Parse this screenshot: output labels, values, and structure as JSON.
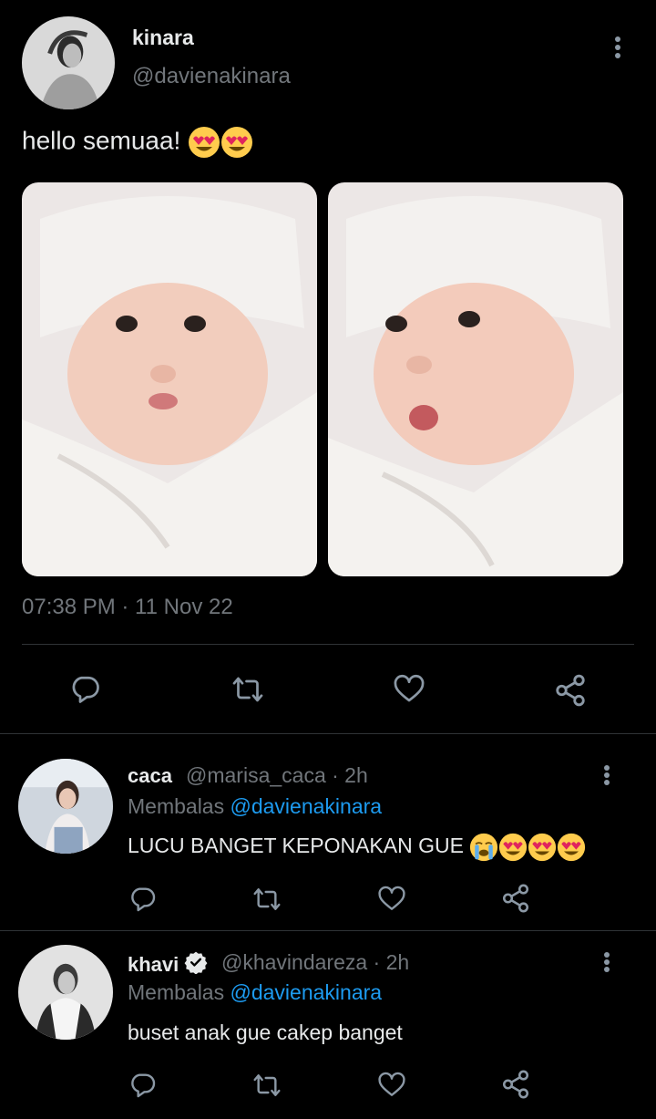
{
  "tweet": {
    "author_name": "kinara",
    "author_handle": "@davienakinara",
    "text": "hello semuaa!",
    "emojis": [
      "heart-eyes",
      "heart-eyes"
    ],
    "timestamp": "07:38 PM · 11 Nov 22",
    "actions": [
      "reply-icon",
      "retweet-icon",
      "like-icon",
      "share-icon"
    ]
  },
  "replies": [
    {
      "name": "caca",
      "meta": "@marisa_caca · 2h",
      "replying_prefix": "Membalas",
      "replying_to": "@davienakinara",
      "text": "LUCU BANGET KEPONAKAN GUE",
      "emojis": [
        "loudly-crying",
        "heart-eyes",
        "heart-eyes",
        "heart-eyes"
      ],
      "verified": false
    },
    {
      "name": "khavi",
      "meta": "@khavindareza · 2h",
      "replying_prefix": "Membalas",
      "replying_to": "@davienakinara",
      "text": "buset anak gue cakep banget",
      "emojis": [],
      "verified": true
    }
  ],
  "colors": {
    "background": "#000000",
    "text": "#e7e9ea",
    "muted": "#71767b",
    "link": "#1d9bf0",
    "divider": "#2f3336"
  }
}
